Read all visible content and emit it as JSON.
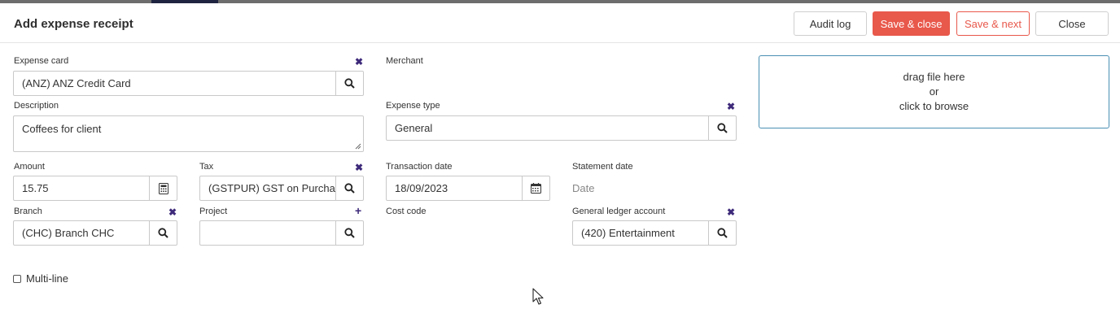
{
  "header": {
    "title": "Add expense receipt",
    "buttons": {
      "audit_log": "Audit log",
      "save_close": "Save & close",
      "save_next": "Save & next",
      "close": "Close"
    }
  },
  "form": {
    "expense_card": {
      "label": "Expense card",
      "value": "(ANZ) ANZ Credit Card"
    },
    "merchant": {
      "label": "Merchant"
    },
    "description": {
      "label": "Description",
      "value": "Coffees for client"
    },
    "expense_type": {
      "label": "Expense type",
      "value": "General"
    },
    "amount": {
      "label": "Amount",
      "value": "15.75"
    },
    "tax": {
      "label": "Tax",
      "value": "(GSTPUR) GST on Purcha"
    },
    "transaction_date": {
      "label": "Transaction date",
      "value": "18/09/2023"
    },
    "statement_date": {
      "label": "Statement date",
      "placeholder": "Date"
    },
    "branch": {
      "label": "Branch",
      "value": "(CHC) Branch CHC"
    },
    "project": {
      "label": "Project",
      "value": ""
    },
    "cost_code": {
      "label": "Cost code"
    },
    "gl_account": {
      "label": "General ledger account",
      "value": "(420) Entertainment"
    },
    "multi_line": {
      "label": "Multi-line",
      "checked": false
    }
  },
  "dropzone": {
    "line1": "drag file here",
    "line2": "or",
    "line3": "click to browse"
  },
  "icons": {
    "clear": "close-x-icon",
    "search": "search-icon",
    "calculator": "calculator-icon",
    "calendar": "calendar-icon",
    "add": "plus-icon"
  },
  "colors": {
    "accent": "#e8584b",
    "icon": "#3e2a7a",
    "dropzone_border": "#4a8fb3"
  }
}
